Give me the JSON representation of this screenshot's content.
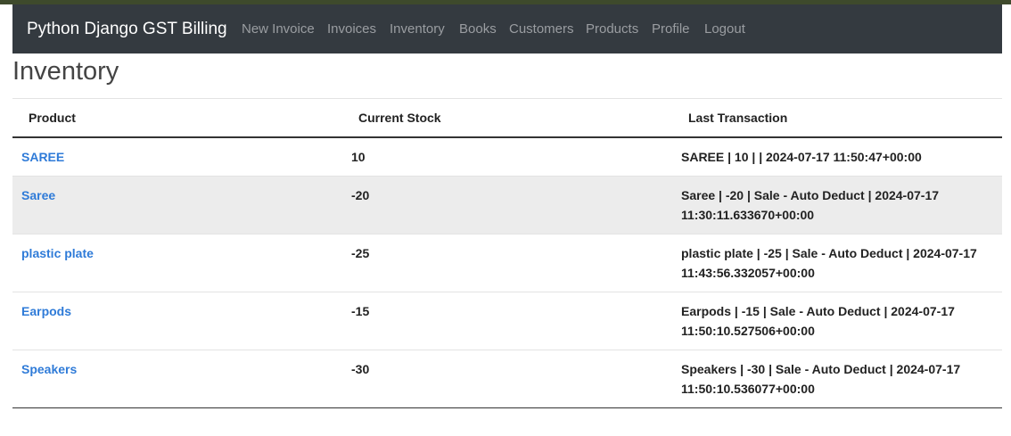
{
  "navbar": {
    "brand": "Python Django GST Billing",
    "links": [
      "New Invoice",
      "Invoices",
      "Inventory",
      "Books",
      "Customers",
      "Products",
      "Profile",
      "Logout"
    ]
  },
  "page": {
    "title": "Inventory"
  },
  "table": {
    "headers": [
      "Product",
      "Current Stock",
      "Last Transaction"
    ],
    "rows": [
      {
        "product": "SAREE",
        "stock": "10",
        "last": "SAREE | 10 | | 2024-07-17 11:50:47+00:00"
      },
      {
        "product": "Saree",
        "stock": "-20",
        "last": "Saree | -20 | Sale - Auto Deduct | 2024-07-17 11:30:11.633670+00:00"
      },
      {
        "product": "plastic plate",
        "stock": "-25",
        "last": "plastic plate | -25 | Sale - Auto Deduct | 2024-07-17 11:43:56.332057+00:00"
      },
      {
        "product": "Earpods",
        "stock": "-15",
        "last": "Earpods | -15 | Sale - Auto Deduct | 2024-07-17 11:50:10.527506+00:00"
      },
      {
        "product": "Speakers",
        "stock": "-30",
        "last": "Speakers | -30 | Sale - Auto Deduct | 2024-07-17 11:50:10.536077+00:00"
      }
    ]
  },
  "colors": {
    "navbar_bg": "#343a40",
    "link": "#2f7bd8",
    "row_shade": "#ececec"
  }
}
